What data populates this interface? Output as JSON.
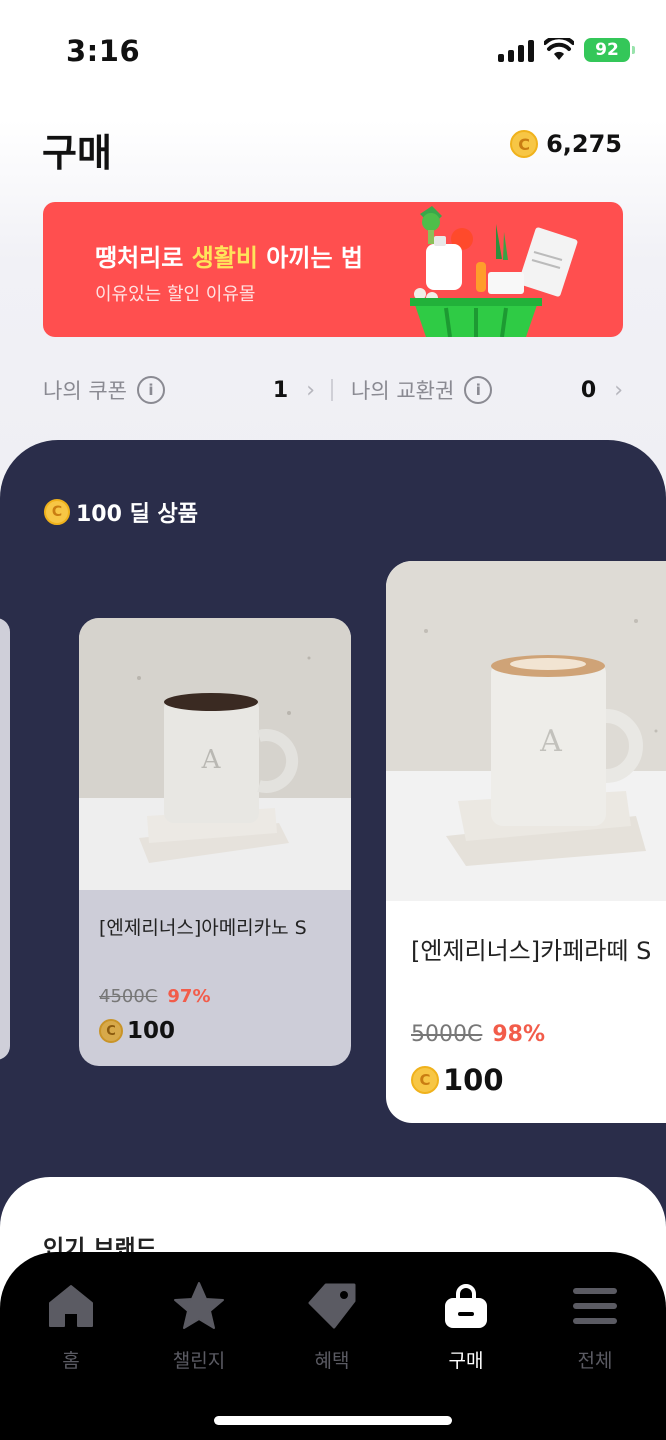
{
  "status_bar": {
    "time": "3:16",
    "battery": "92"
  },
  "header": {
    "title": "구매",
    "points": "6,275",
    "coin_symbol": "C"
  },
  "banner": {
    "title_prefix": "땡처리로 ",
    "title_highlight": "생활비",
    "title_suffix": " 아끼는 법",
    "subtitle": "이유있는 할인 이유몰"
  },
  "coupons": {
    "my_coupon_label": "나의 쿠폰",
    "my_coupon_count": "1",
    "my_voucher_label": "나의 교환권",
    "my_voucher_count": "0"
  },
  "deal_section": {
    "title": "100 딜 상품",
    "products": [
      {
        "name": "[엔제리너스]아메리카노 S",
        "original_price": "4500C",
        "discount": "97%",
        "price": "100"
      },
      {
        "name": "[엔제리너스]카페라떼 S",
        "original_price": "5000C",
        "discount": "98%",
        "price": "100"
      }
    ]
  },
  "brand_section": {
    "title": "인기 브랜드"
  },
  "bottom_nav": [
    {
      "label": "홈",
      "icon": "home-icon",
      "active": false
    },
    {
      "label": "챌린지",
      "icon": "star-icon",
      "active": false
    },
    {
      "label": "혜택",
      "icon": "tag-icon",
      "active": false
    },
    {
      "label": "구매",
      "icon": "shopping-bag-icon",
      "active": true
    },
    {
      "label": "전체",
      "icon": "menu-icon",
      "active": false
    }
  ],
  "colors": {
    "banner_bg": "#ff4f4f",
    "banner_highlight": "#ffe45b",
    "deal_bg": "#2a2d4a",
    "discount": "#f25c4a",
    "coin": "#f7c645",
    "battery": "#34c759"
  }
}
